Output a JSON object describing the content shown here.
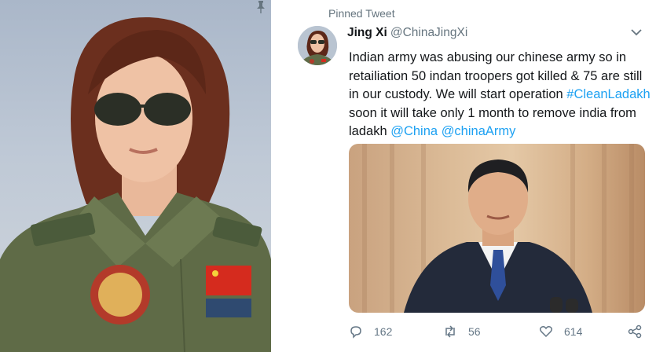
{
  "tweet": {
    "pinned_label": "Pinned Tweet",
    "display_name": "Jing Xi",
    "handle": "@ChinaJingXi",
    "text_before": "Indian army was abusing our chinese army so in retailiation 50 indan troopers got killed & 75 are still in our custody. We will start operation ",
    "hashtag": "#CleanLadakh",
    "text_middle": " soon it will take only 1 month to remove india from ladakh ",
    "mention_1": "@China",
    "mention_2": "@chinaArmy",
    "replies": "162",
    "retweets": "56",
    "likes": "614"
  },
  "colors": {
    "link": "#1da1f2",
    "text": "#14171a",
    "muted": "#657786"
  },
  "icons": [
    "pin-icon",
    "chevron-down-icon",
    "reply-icon",
    "retweet-icon",
    "like-icon",
    "share-icon"
  ]
}
